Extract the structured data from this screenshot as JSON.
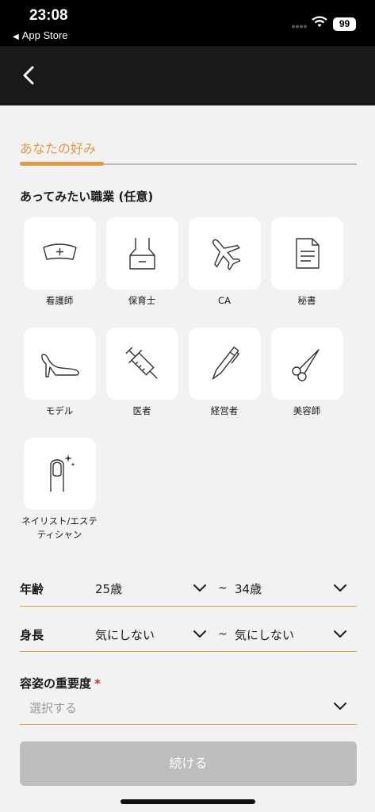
{
  "status_bar": {
    "time": "23:08",
    "back_app": "App Store",
    "battery": "99"
  },
  "page": {
    "section_title": "あなたの好み",
    "progress_fraction": 0.25
  },
  "jobs": {
    "heading": "あってみたい職業 (任意)",
    "items": [
      {
        "label": "看護師",
        "icon": "nurse-cap-icon"
      },
      {
        "label": "保育士",
        "icon": "apron-icon"
      },
      {
        "label": "CA",
        "icon": "airplane-icon"
      },
      {
        "label": "秘書",
        "icon": "document-icon"
      },
      {
        "label": "モデル",
        "icon": "high-heel-icon"
      },
      {
        "label": "医者",
        "icon": "syringe-icon"
      },
      {
        "label": "経営者",
        "icon": "pen-icon"
      },
      {
        "label": "美容師",
        "icon": "scissors-icon"
      },
      {
        "label_line1": "ネイリスト/エステ",
        "label_line2": "ティシャン",
        "icon": "nail-icon"
      }
    ]
  },
  "age": {
    "label": "年齢",
    "from": "25歳",
    "separator": "~",
    "to": "34歳"
  },
  "height": {
    "label": "身長",
    "from": "気にしない",
    "separator": "~",
    "to": "気にしない"
  },
  "looks": {
    "label": "容姿の重要度",
    "required_mark": "*",
    "placeholder": "選択する"
  },
  "continue_label": "続ける"
}
